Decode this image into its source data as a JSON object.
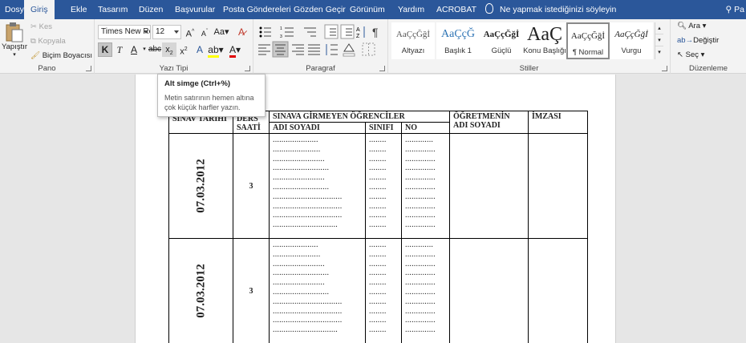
{
  "tabs": [
    "Dosya",
    "Giriş",
    "Ekle",
    "Tasarım",
    "Düzen",
    "Başvurular",
    "Posta Göndereleri",
    "Gözden Geçir",
    "Görünüm",
    "Yardım",
    "ACROBAT"
  ],
  "active_tab": "Giriş",
  "tell_me": "Ne yapmak istediğinizi söyleyin",
  "user_initial": "Pa",
  "clipboard": {
    "paste_label": "Yapıştır",
    "cut_label": "Kes",
    "copy_label": "Kopyala",
    "format_painter_label": "Biçim Boyacısı",
    "group_label": "Pano"
  },
  "font": {
    "family_value": "Times New Ro",
    "size_value": "12",
    "group_label": "Yazı Tipi",
    "bold_glyph": "K",
    "italic_glyph": "T",
    "underline_glyph": "A"
  },
  "paragraph": {
    "group_label": "Paragraf"
  },
  "styles": {
    "group_label": "Stiller",
    "items": [
      {
        "preview": "AaÇçĞğİ",
        "name": "Altyazı"
      },
      {
        "preview": "AaÇçĞ",
        "name": "Başlık 1"
      },
      {
        "preview": "AaÇçĞğİ",
        "name": "Güçlü"
      },
      {
        "preview": "AaÇ",
        "name": "Konu Başlığı"
      },
      {
        "preview": "AaÇçĞğİ",
        "name": "¶ Normal"
      },
      {
        "preview": "AaÇçĞğİ",
        "name": "Vurgu"
      }
    ]
  },
  "editing": {
    "find_label": "Ara",
    "replace_label": "Değiştir",
    "select_label": "Seç",
    "group_label": "Düzenleme"
  },
  "tooltip": {
    "title": "Alt simge (Ctrl+%)",
    "description": "Metin satırının hemen altına çok küçük harfler yazın."
  },
  "table": {
    "header": {
      "date": "SINAV TARİHİ",
      "hour": "DERS SAATİ",
      "students": "SINAVA GİRMEYEN ÖĞRENCİLER",
      "name": "ADI SOYADI",
      "class": "SINIFI",
      "no": "NO",
      "teacher": "ÖĞRETMENİN ADI SOYADI",
      "signature": "İMZASI"
    },
    "rows": [
      {
        "date": "07.03.2012",
        "hour": "3"
      },
      {
        "date": "07.03.2012",
        "hour": "3"
      }
    ],
    "name_dots": [
      ".....................",
      "......................",
      "........................",
      "..........................",
      "........................",
      "..........................",
      "................................",
      "................................",
      "................................",
      ".............................."
    ],
    "class_dots": [
      "........",
      "........",
      "........",
      "........",
      "........",
      "........",
      "........",
      "........",
      "........",
      "........"
    ],
    "no_dots": [
      ".............",
      "..............",
      "..............",
      "..............",
      "..............",
      "..............",
      "..............",
      "..............",
      "..............",
      ".............."
    ]
  }
}
